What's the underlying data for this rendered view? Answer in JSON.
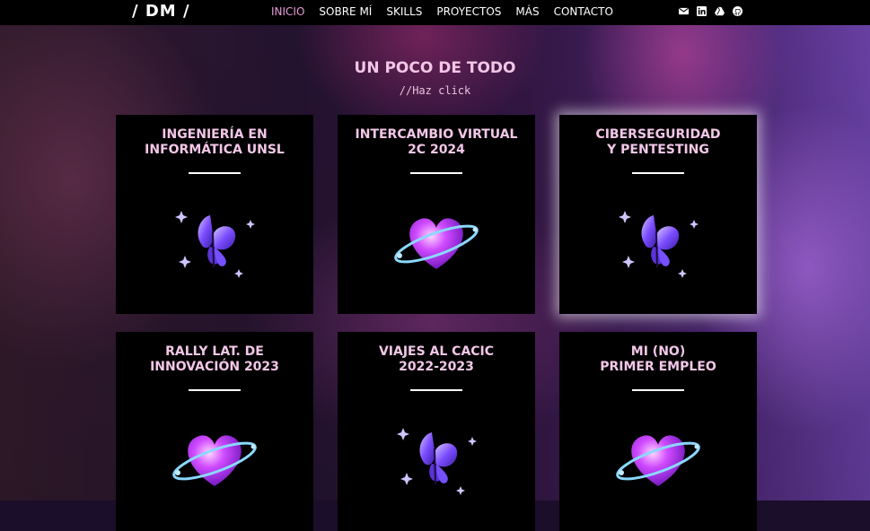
{
  "header": {
    "logo": "/ DM /",
    "nav": [
      "INICIO",
      "SOBRE MÍ",
      "SKILLS",
      "PROYECTOS",
      "MÁS",
      "CONTACTO"
    ],
    "social_icons": [
      "mail-icon",
      "linkedin-icon",
      "drive-icon",
      "github-icon"
    ]
  },
  "section": {
    "title": "UN POCO DE TODO",
    "subtitle": "//Haz click"
  },
  "cards": [
    {
      "title": "INGENIERÍA EN\nINFORMÁTICA UNSL",
      "icon": "butterfly-icon"
    },
    {
      "title": "INTERCAMBIO VIRTUAL\n2C 2024",
      "icon": "heart-icon"
    },
    {
      "title": "CIBERSEGURIDAD\nY PENTESTING",
      "icon": "butterfly-icon"
    },
    {
      "title": "RALLY LAT. DE\nINNOVACIÓN 2023",
      "icon": "heart-icon"
    },
    {
      "title": "VIAJES AL CACIC\n2022-2023",
      "icon": "butterfly-icon"
    },
    {
      "title": "MI (NO)\nPRIMER EMPLEO",
      "icon": "heart-icon"
    }
  ],
  "colors": {
    "accent": "#e69ad8",
    "card_title": "#f3c7e8",
    "card_bg": "#000000"
  }
}
